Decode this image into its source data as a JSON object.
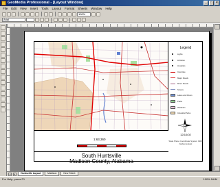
{
  "window": {
    "title": "GeoMedia Professional - [Layout Window]"
  },
  "menu": [
    "File",
    "Edit",
    "View",
    "Insert",
    "Tools",
    "Layout",
    "Format",
    "Sheets",
    "Window",
    "Help"
  ],
  "toolbar": {
    "scale_combo": "100%",
    "font_combo": "Arial"
  },
  "map": {
    "title_line1": "South Huntsville",
    "title_line2": "Madison County, Alabama",
    "scale_text": "1:63,360",
    "date": "12/10/02",
    "projection": "State Plane Coordinate System 1983 Alabama East",
    "legend_title": "Legend",
    "legend": [
      {
        "label": "Lights",
        "swatch": "dot",
        "color": "#000000"
      },
      {
        "label": "Libraries",
        "swatch": "dot",
        "color": "#c00000"
      },
      {
        "label": "Hospitals",
        "swatch": "dot",
        "color": "#800000"
      },
      {
        "label": "Interstate",
        "swatch": "line",
        "color": "#d00000"
      },
      {
        "label": "Major Roads",
        "swatch": "line",
        "color": "#e04040"
      },
      {
        "label": "Minor Roads",
        "swatch": "line",
        "color": "#a06080"
      },
      {
        "label": "Streets",
        "swatch": "line",
        "color": "#8090c0"
      },
      {
        "label": "Lakes and Rivers",
        "swatch": "box",
        "color": "#7090d0"
      },
      {
        "label": "Parks",
        "swatch": "box",
        "color": "#90d090"
      },
      {
        "label": "Wetlands",
        "swatch": "box",
        "color": "#e8c0d8"
      },
      {
        "label": "Industrial Parks",
        "swatch": "box",
        "color": "#f0d8b0"
      }
    ],
    "colors": {
      "urban": "#e8d0b8",
      "park": "#a8e0a0",
      "water": "#6080d0",
      "road": "#d02020"
    }
  },
  "tabs": [
    "Huntsville Layout",
    "Madison",
    "New Sheet"
  ],
  "status": {
    "left": "For Help, press F1",
    "right": "100% NUM"
  }
}
